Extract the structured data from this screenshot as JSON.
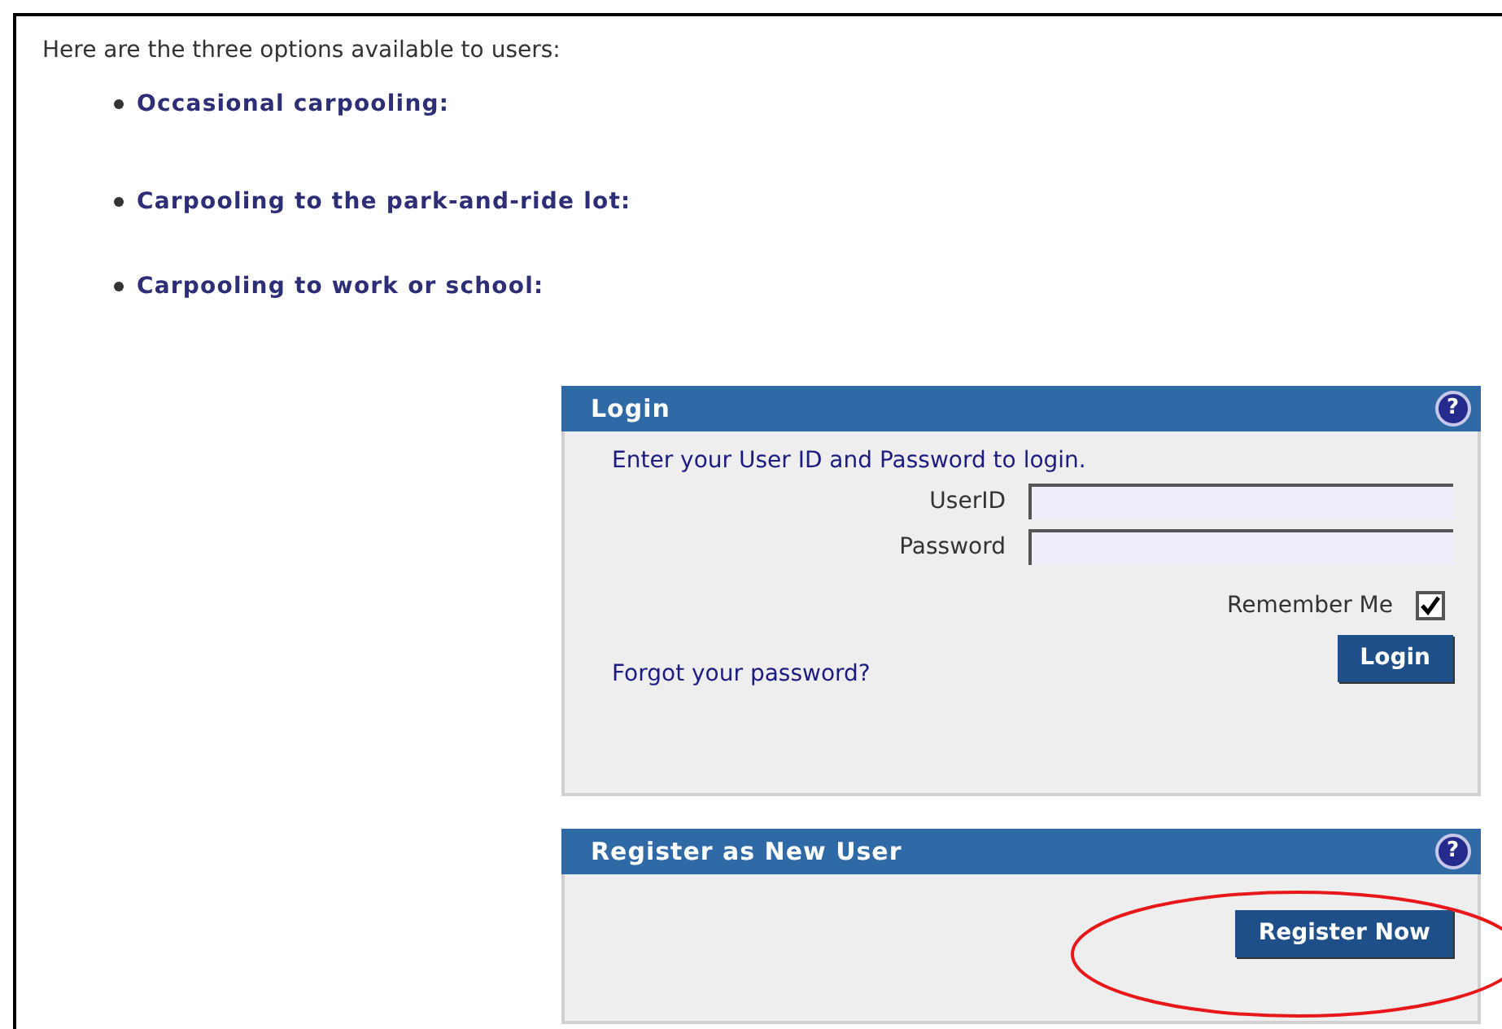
{
  "intro": "Here are the three options available to users:",
  "options": [
    "Occasional carpooling:",
    "Carpooling to the park-and-ride lot:",
    "Carpooling to work or school:"
  ],
  "login_panel": {
    "title": "Login",
    "help": "?",
    "instruction": "Enter your User ID and Password to login.",
    "fields": [
      {
        "label": "UserID"
      },
      {
        "label": "Password"
      }
    ],
    "remember_me": {
      "label": "Remember Me",
      "checked": true
    },
    "forgot_link": "Forgot your password?",
    "button": "Login"
  },
  "register_panel": {
    "title": "Register as New User",
    "help": "?",
    "button": "Register Now"
  }
}
